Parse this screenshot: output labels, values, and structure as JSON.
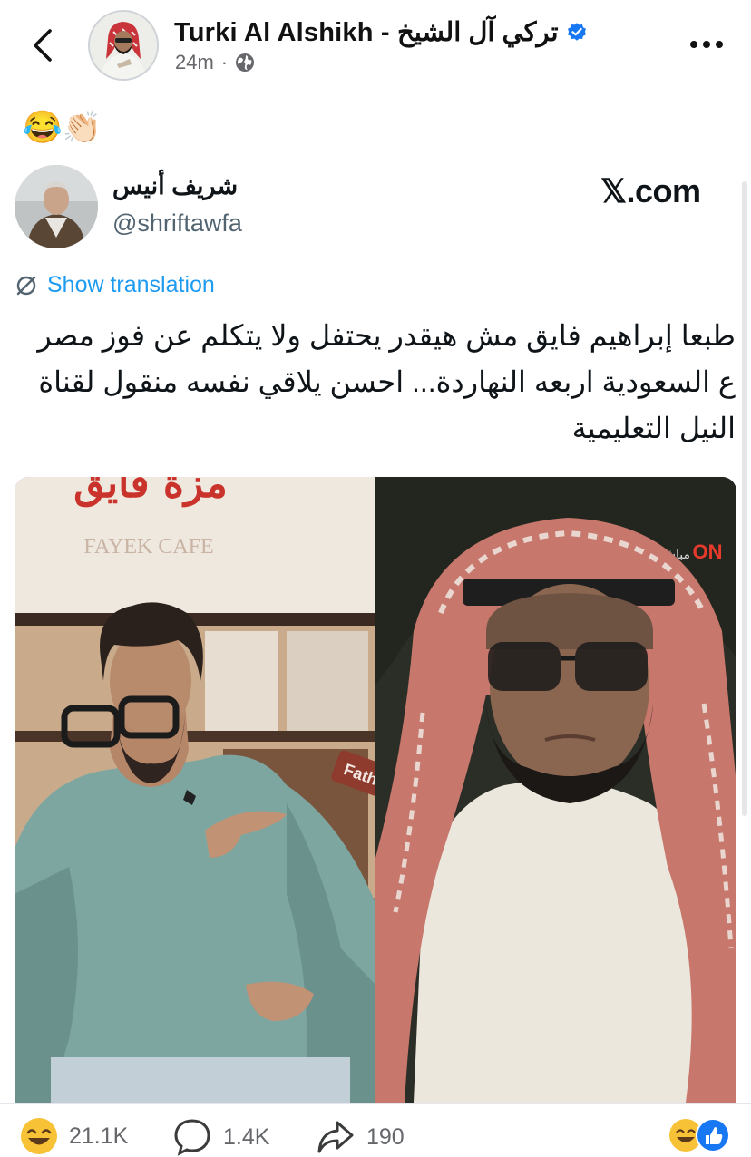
{
  "header": {
    "author_name": "Turki Al Alshikh - تركي  آل  الشيخ",
    "time": "24m",
    "separator": "·"
  },
  "post": {
    "caption": "😂👏🏻"
  },
  "tweet": {
    "display_name": "شريف أنيس",
    "handle": "@shriftawfa",
    "source": "𝕏.com",
    "translate_label": "Show translation",
    "text": "طبعا إبراهيم فايق مش هيقدر يحتفل ولا يتكلم عن فوز مصر ع السعودية اربعه النهاردة... احسن يلاقي نفسه منقول لقناة النيل التعليمية",
    "media": {
      "left_sign_top": "مزة فايق",
      "left_sign_sub": "FAYEK CAFE",
      "watermark": "Fathy",
      "channel_logo": "ON",
      "channel_live": "مباشر"
    }
  },
  "footer": {
    "reactions_count": "21.1K",
    "comments_count": "1.4K",
    "shares_count": "190"
  },
  "colors": {
    "accent_blue": "#1877f2",
    "link_blue": "#1d9bf0",
    "muted_text": "#65676b"
  }
}
